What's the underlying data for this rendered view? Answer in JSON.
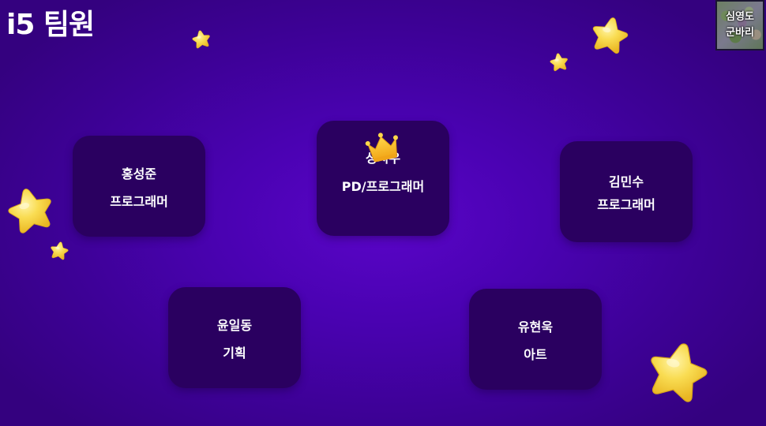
{
  "header": {
    "title": "i5 팀원"
  },
  "badge": {
    "line1": "심영도",
    "line2": "군바리"
  },
  "members": [
    {
      "name": "홍성준",
      "role": "프로그래머"
    },
    {
      "name": "성시우",
      "role": "PD/프로그래머"
    },
    {
      "name": "김민수",
      "role": "프로그래머"
    },
    {
      "name": "윤일동",
      "role": "기획"
    },
    {
      "name": "유현욱",
      "role": "아트"
    }
  ],
  "decorations": {
    "crown_icon": "crown-icon",
    "star_icon": "star-icon",
    "star_color": "#f7d64a",
    "background_color": "#4a02b2",
    "card_color": "#2a0060"
  }
}
